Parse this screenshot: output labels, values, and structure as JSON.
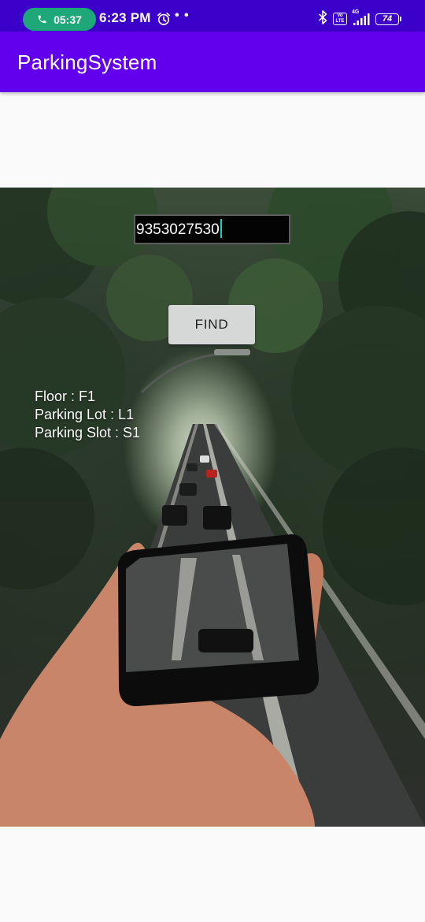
{
  "status_bar": {
    "call_timer": "05:37",
    "time": "6:23 PM",
    "more": "• •",
    "network_label": "4G",
    "volte_label": "Vo LTE",
    "battery_level": "74",
    "icons": [
      "phone-icon",
      "alarm-icon",
      "bluetooth-icon",
      "volte-icon",
      "signal-icon",
      "battery-icon"
    ]
  },
  "app_bar": {
    "title": "ParkingSystem"
  },
  "search": {
    "phone_value": "9353027530",
    "find_label": "FIND"
  },
  "result": {
    "floor": "Floor : F1",
    "lot": "Parking Lot : L1",
    "slot": "Parking Slot : S1"
  },
  "colors": {
    "status_bar": "#3b00c9",
    "app_bar": "#6200ee",
    "call_pill": "#1ea87a",
    "caret": "#03dac5",
    "button": "#d6d7d7"
  }
}
